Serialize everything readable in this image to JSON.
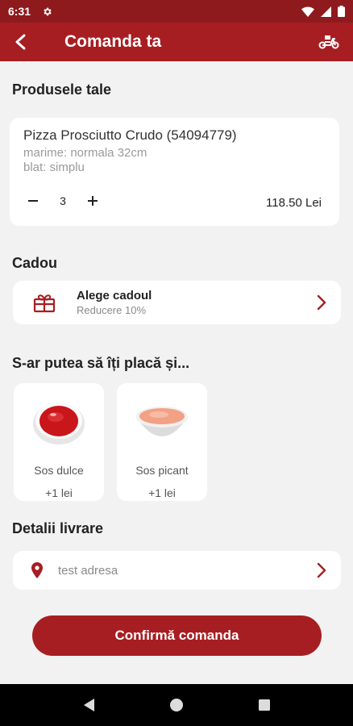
{
  "status_bar": {
    "time": "6:31"
  },
  "header": {
    "title": "Comanda ta"
  },
  "products_section": {
    "title": "Produsele tale"
  },
  "product": {
    "name": "Pizza Prosciutto Crudo (54094779)",
    "size": "marime: normala 32cm",
    "crust": "blat: simplu",
    "quantity": "3",
    "price": "118.50 Lei"
  },
  "gift_section": {
    "title": "Cadou",
    "item_title": "Alege cadoul",
    "item_subtitle": "Reducere 10%"
  },
  "suggestions": {
    "title": "S-ar putea să îți placă și...",
    "items": [
      {
        "name": "Sos dulce",
        "price": "+1 lei"
      },
      {
        "name": "Sos picant",
        "price": "+1 lei"
      }
    ]
  },
  "delivery": {
    "title": "Detalii livrare",
    "address": "test adresa"
  },
  "confirm_button": {
    "label": "Confirmă comanda"
  },
  "colors": {
    "primary": "#a71e22",
    "status_bar": "#8e1a1d",
    "background": "#f2f2f2"
  }
}
